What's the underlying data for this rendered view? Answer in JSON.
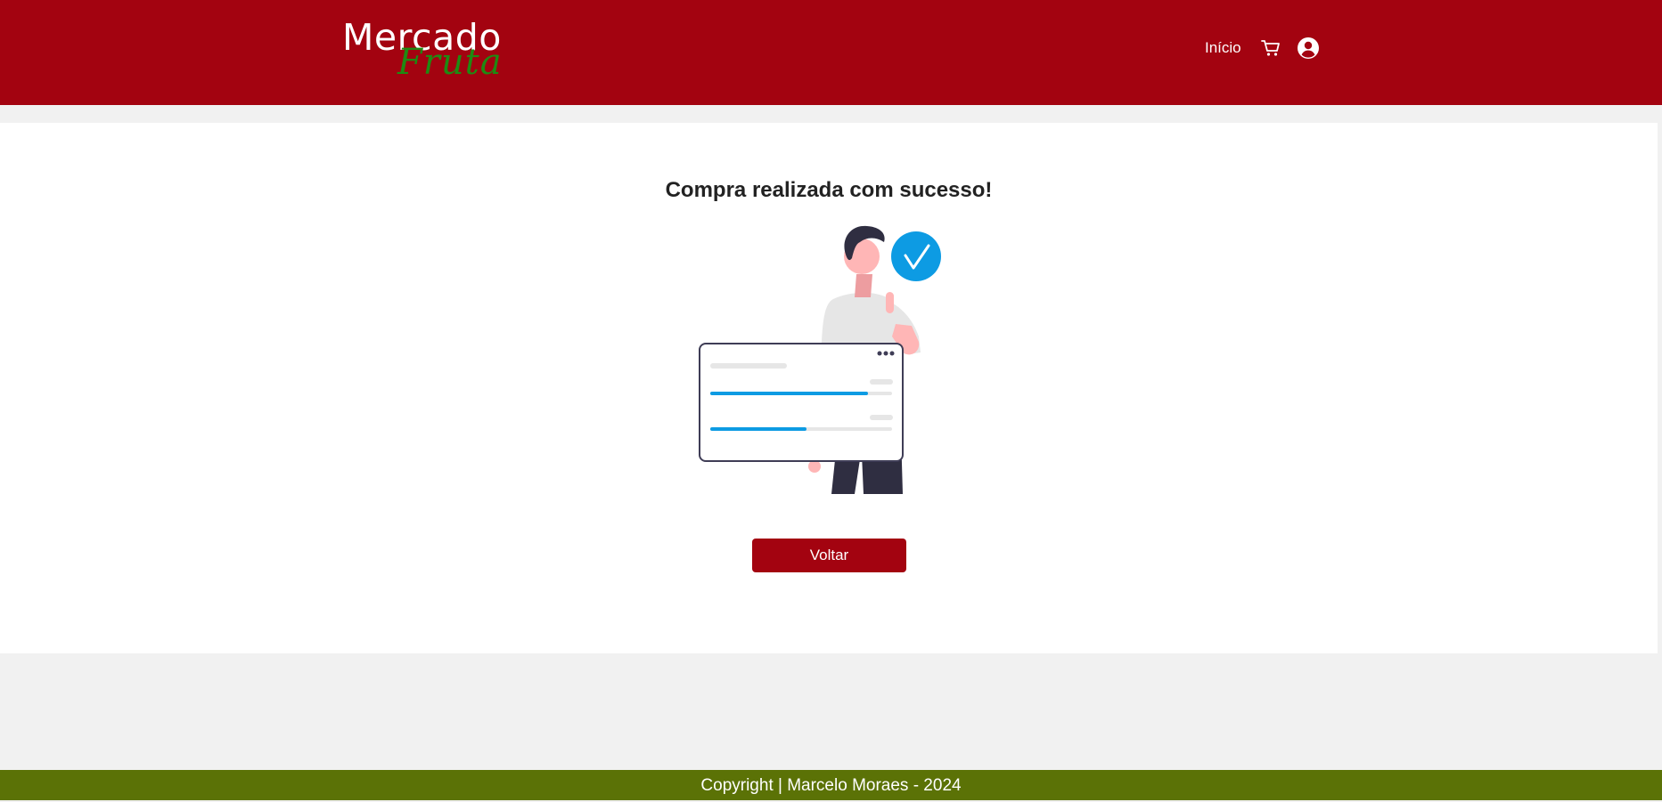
{
  "header": {
    "brand": {
      "main": "Mercado",
      "script": "Fruta"
    },
    "nav": {
      "home_label": "Início",
      "cart_icon": "cart-icon",
      "account_icon": "user-circle-icon"
    }
  },
  "main": {
    "title": "Compra realizada com sucesso!",
    "illustration_icon": "success-checkmark-person-illustration",
    "back_button_label": "Voltar"
  },
  "footer": {
    "copyright": "Copyright | Marcelo Moraes - 2024"
  },
  "colors": {
    "brand_red": "#a30310",
    "brand_green": "#1f8a12",
    "footer_green": "#5b7206",
    "accent_blue": "#0d9be3",
    "background": "#f1f1f1"
  }
}
